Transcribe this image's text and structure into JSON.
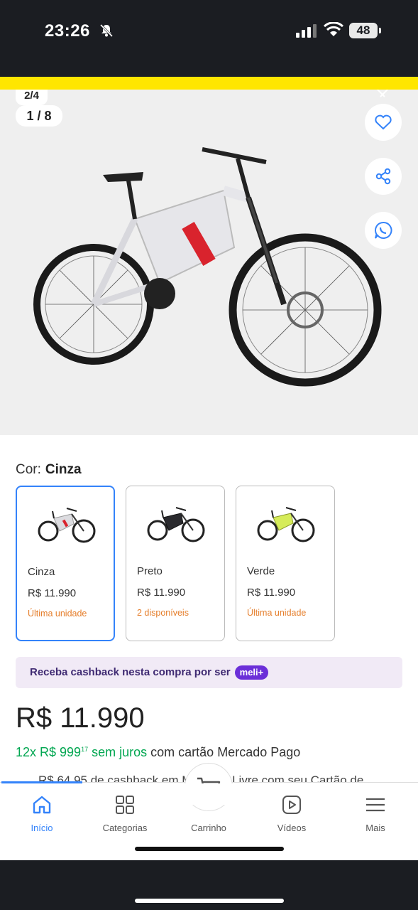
{
  "status_bar": {
    "time": "23:26",
    "battery": "48"
  },
  "gallery": {
    "page_counter": "2/4",
    "image_counter": "1 / 8"
  },
  "variant": {
    "label": "Cor:",
    "selected": "Cinza",
    "options": [
      {
        "name": "Cinza",
        "price": "R$ 11.990",
        "stock": "Última unidade"
      },
      {
        "name": "Preto",
        "price": "R$ 11.990",
        "stock": "2 disponíveis"
      },
      {
        "name": "Verde",
        "price": "R$ 11.990",
        "stock": "Última unidade"
      }
    ]
  },
  "cashback": {
    "text": "Receba cashback nesta compra por ser",
    "badge": "meli+"
  },
  "price": {
    "main": "R$ 11.990"
  },
  "installments": {
    "prefix": "12x R$ 999",
    "cents": "17",
    "free": "sem juros",
    "suffix": "com cartão Mercado Pago"
  },
  "cashback_line": "R$ 64,95 de cashback em Mercado Livre com seu Cartão de",
  "tabbar": {
    "items": [
      {
        "label": "Início"
      },
      {
        "label": "Categorias"
      },
      {
        "label": "Carrinho"
      },
      {
        "label": "Vídeos"
      },
      {
        "label": "Mais"
      }
    ]
  },
  "colors": {
    "accent": "#3483fa",
    "yellow": "#ffe600",
    "green": "#00a650",
    "orange": "#e57e2b",
    "meli_purple": "#6b2fd8"
  }
}
